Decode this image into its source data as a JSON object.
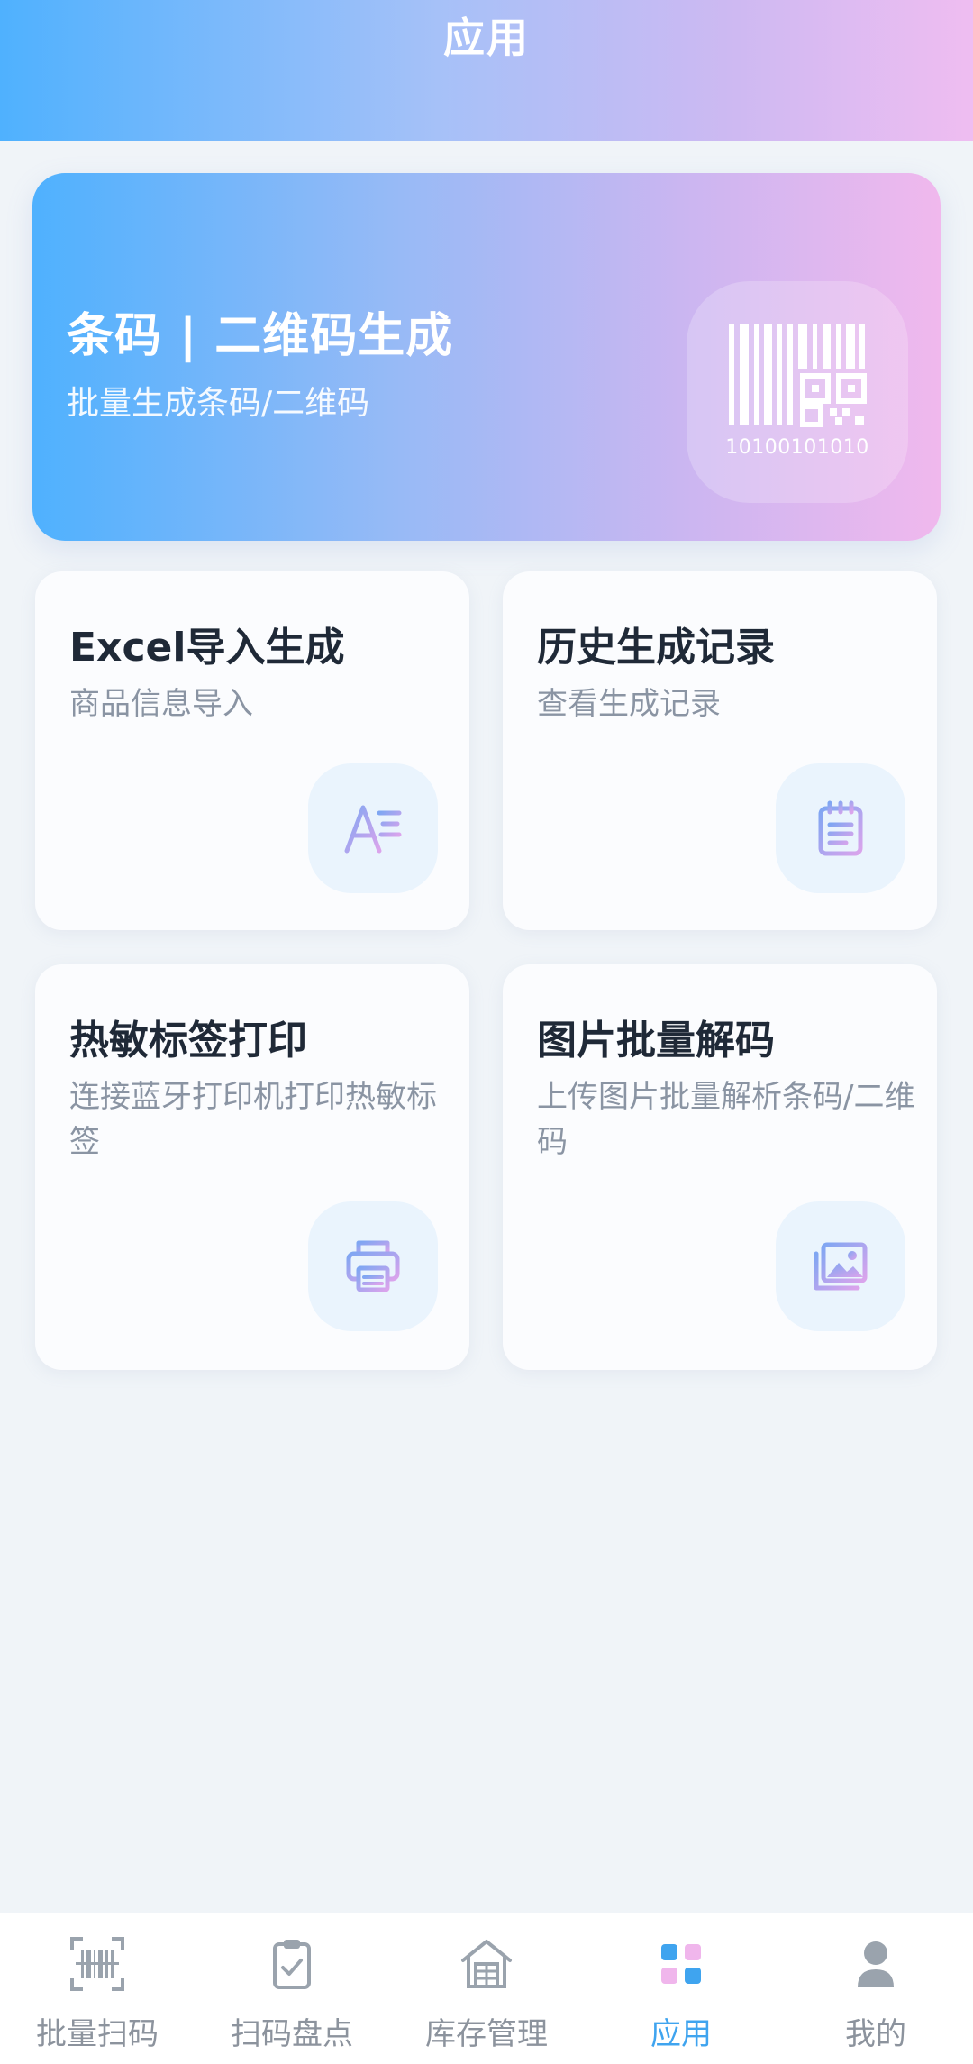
{
  "header": {
    "title": "应用"
  },
  "banner": {
    "title": "条码 | 二维码生成",
    "subtitle": "批量生成条码/二维码",
    "icon": "barcode-qrcode-icon",
    "icon_digits": "10100101010"
  },
  "cards": [
    {
      "title": "Excel导入生成",
      "desc": "商品信息导入",
      "icon": "text-format-icon"
    },
    {
      "title": "历史生成记录",
      "desc": "查看生成记录",
      "icon": "notepad-icon"
    },
    {
      "title": "热敏标签打印",
      "desc": "连接蓝牙打印机打印热敏标签",
      "icon": "printer-icon"
    },
    {
      "title": "图片批量解码",
      "desc": "上传图片批量解析条码/二维码",
      "icon": "images-icon"
    }
  ],
  "bottom_nav": {
    "items": [
      {
        "label": "批量扫码",
        "icon": "scan-barcode-icon",
        "active": false
      },
      {
        "label": "扫码盘点",
        "icon": "clipboard-check-icon",
        "active": false
      },
      {
        "label": "库存管理",
        "icon": "warehouse-icon",
        "active": false
      },
      {
        "label": "应用",
        "icon": "apps-grid-icon",
        "active": true
      },
      {
        "label": "我的",
        "icon": "user-icon",
        "active": false
      }
    ]
  },
  "colors": {
    "accent": "#3fa4ef",
    "header_gradient_start": "#4fb1fe",
    "header_gradient_end": "#efbdf1",
    "icon_gradient_start": "#7fa6f2",
    "icon_gradient_end": "#dba4ec"
  }
}
